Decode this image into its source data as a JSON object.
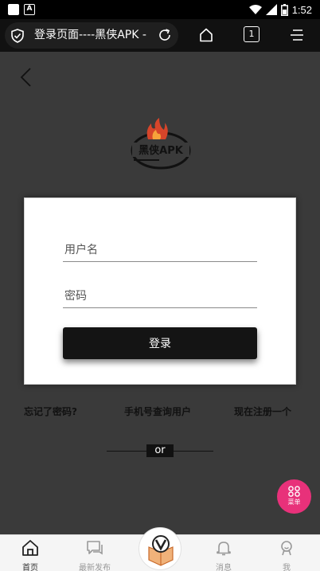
{
  "status_bar": {
    "time": "1:52",
    "notification_icon_letter": "A"
  },
  "browser": {
    "page_title": "登录页面----黑侠APK -",
    "tab_count": "1"
  },
  "logo": {
    "brand_text": "黑侠APK"
  },
  "login": {
    "username_placeholder": "用户名",
    "password_placeholder": "密码",
    "login_label": "登录"
  },
  "links": {
    "forgot_password": "忘记了密码?",
    "phone_lookup": "手机号查询用户",
    "register": "现在注册一个"
  },
  "divider_text": "or",
  "fab": {
    "label": "菜单",
    "color": "#e8317a"
  },
  "tabs": [
    {
      "label": "首页"
    },
    {
      "label": "最新发布"
    },
    {
      "label": "消息"
    },
    {
      "label": "我"
    }
  ]
}
